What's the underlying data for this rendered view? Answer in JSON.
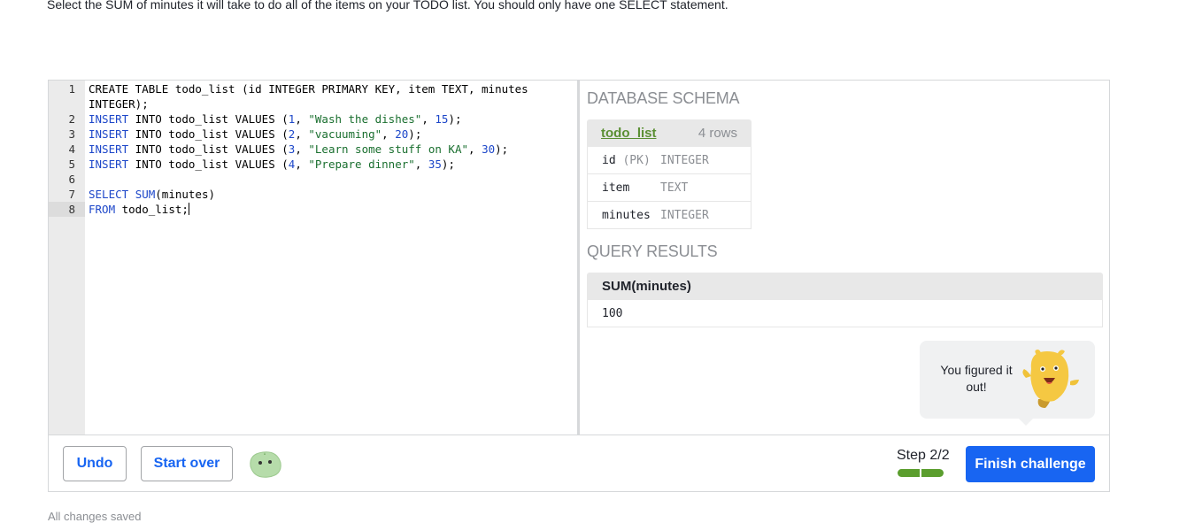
{
  "instructions": "Select the SUM of minutes it will take to do all of the items on your TODO list. You should only have one SELECT statement.",
  "editor": {
    "lines": [
      {
        "n": "1",
        "text": "CREATE TABLE todo_list (id INTEGER PRIMARY KEY, item TEXT, minutes INTEGER);"
      },
      {
        "n": "2",
        "text": "INSERT INTO todo_list VALUES (1, \"Wash the dishes\", 15);"
      },
      {
        "n": "3",
        "text": "INSERT INTO todo_list VALUES (2, \"vacuuming\", 20);"
      },
      {
        "n": "4",
        "text": "INSERT INTO todo_list VALUES (3, \"Learn some stuff on KA\", 30);"
      },
      {
        "n": "5",
        "text": "INSERT INTO todo_list VALUES (4, \"Prepare dinner\", 35);"
      },
      {
        "n": "6",
        "text": ""
      },
      {
        "n": "7",
        "text": "SELECT SUM(minutes)"
      },
      {
        "n": "8",
        "text": "FROM todo_list;"
      }
    ],
    "active_line": 8
  },
  "schema": {
    "title": "DATABASE SCHEMA",
    "table_name": "todo_list",
    "row_count": "4 rows",
    "columns": [
      {
        "name": "id",
        "pk": "(PK)",
        "type": "INTEGER"
      },
      {
        "name": "item",
        "pk": "",
        "type": "TEXT"
      },
      {
        "name": "minutes",
        "pk": "",
        "type": "INTEGER"
      }
    ]
  },
  "results": {
    "title": "QUERY RESULTS",
    "header": "SUM(minutes)",
    "value": "100"
  },
  "bubble": {
    "text": "You figured it out!"
  },
  "footer": {
    "undo_label": "Undo",
    "start_over_label": "Start over",
    "step_label": "Step 2/2",
    "progress": {
      "current": 2,
      "total": 2
    },
    "finish_label": "Finish challenge",
    "status": "All changes saved"
  },
  "colors": {
    "accent": "#1865f2",
    "progress": "#5b9e2e",
    "schema_link": "#5a8f33"
  },
  "icons": [
    "mascot-winston-icon",
    "blob-hint-icon"
  ]
}
